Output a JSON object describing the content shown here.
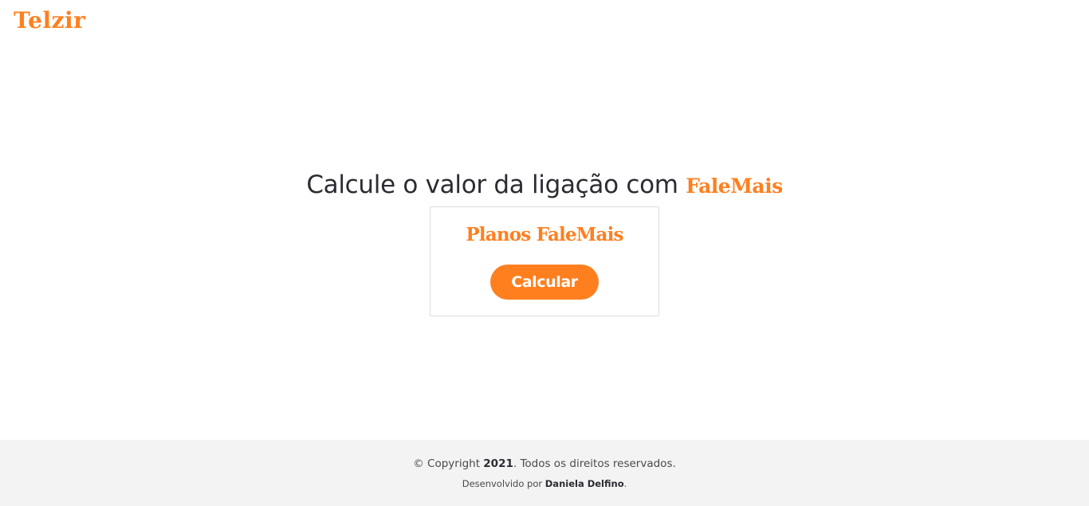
{
  "colors": {
    "accent": "#ff7f1f",
    "text_dark": "#2b2b33",
    "footer_bg": "#f3f3f3"
  },
  "header": {
    "logo_text": "Telzir"
  },
  "main": {
    "headline_prefix": "Calcule o valor da ligação com ",
    "headline_brand": "FaleMais",
    "card": {
      "title": "Planos FaleMais",
      "button_label": "Calcular"
    }
  },
  "footer": {
    "copyright_prefix": "© Copyright ",
    "copyright_year": "2021",
    "copyright_suffix": ". Todos os direitos reservados.",
    "dev_prefix": "Desenvolvido por ",
    "dev_name": "Daniela Delfino",
    "dev_suffix": "."
  }
}
